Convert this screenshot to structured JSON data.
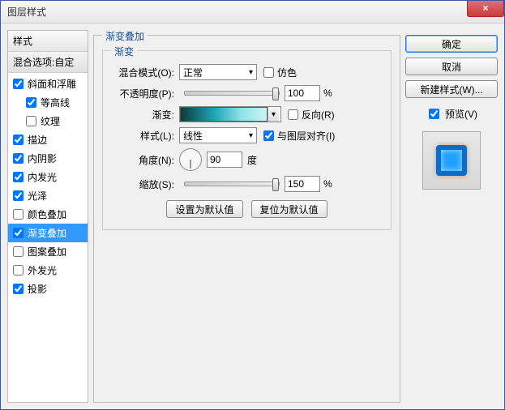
{
  "window": {
    "title": "图层样式"
  },
  "left": {
    "header": "样式",
    "sub": "混合选项:自定",
    "items": [
      {
        "label": "斜面和浮雕",
        "checked": true,
        "indent": false
      },
      {
        "label": "等高线",
        "checked": true,
        "indent": true
      },
      {
        "label": "纹理",
        "checked": false,
        "indent": true
      },
      {
        "label": "描边",
        "checked": true,
        "indent": false
      },
      {
        "label": "内阴影",
        "checked": true,
        "indent": false
      },
      {
        "label": "内发光",
        "checked": true,
        "indent": false
      },
      {
        "label": "光泽",
        "checked": true,
        "indent": false
      },
      {
        "label": "颜色叠加",
        "checked": false,
        "indent": false
      },
      {
        "label": "渐变叠加",
        "checked": true,
        "indent": false,
        "selected": true
      },
      {
        "label": "图案叠加",
        "checked": false,
        "indent": false
      },
      {
        "label": "外发光",
        "checked": false,
        "indent": false
      },
      {
        "label": "投影",
        "checked": true,
        "indent": false
      }
    ]
  },
  "center": {
    "group_title": "渐变叠加",
    "inner_title": "渐变",
    "blend_label": "混合模式(O):",
    "blend_value": "正常",
    "dither_label": "仿色",
    "dither_checked": false,
    "opacity_label": "不透明度(P):",
    "opacity_value": "100",
    "opacity_unit": "%",
    "gradient_label": "渐变:",
    "reverse_label": "反向(R)",
    "reverse_checked": false,
    "style_label": "样式(L):",
    "style_value": "线性",
    "align_label": "与图层对齐(I)",
    "align_checked": true,
    "angle_label": "角度(N):",
    "angle_value": "90",
    "angle_unit": "度",
    "scale_label": "缩放(S):",
    "scale_value": "150",
    "scale_unit": "%",
    "btn_default": "设置为默认值",
    "btn_reset": "复位为默认值"
  },
  "right": {
    "ok": "确定",
    "cancel": "取消",
    "newstyle": "新建样式(W)...",
    "preview_label": "预览(V)",
    "preview_checked": true
  }
}
